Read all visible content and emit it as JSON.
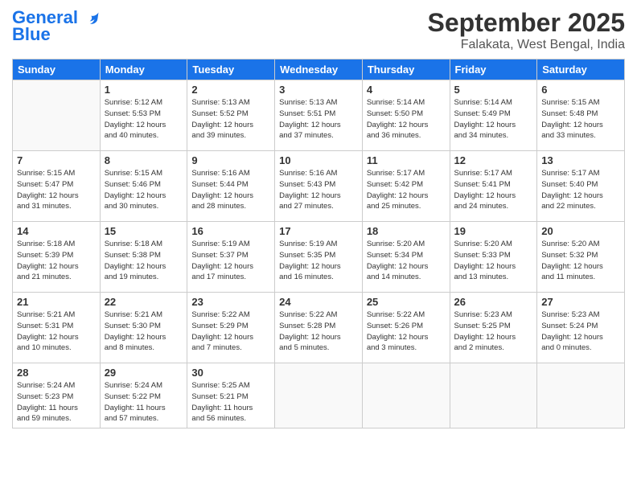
{
  "header": {
    "logo_line1": "General",
    "logo_line2": "Blue",
    "month": "September 2025",
    "location": "Falakata, West Bengal, India"
  },
  "weekdays": [
    "Sunday",
    "Monday",
    "Tuesday",
    "Wednesday",
    "Thursday",
    "Friday",
    "Saturday"
  ],
  "weeks": [
    [
      {
        "day": "",
        "info": ""
      },
      {
        "day": "1",
        "info": "Sunrise: 5:12 AM\nSunset: 5:53 PM\nDaylight: 12 hours\nand 40 minutes."
      },
      {
        "day": "2",
        "info": "Sunrise: 5:13 AM\nSunset: 5:52 PM\nDaylight: 12 hours\nand 39 minutes."
      },
      {
        "day": "3",
        "info": "Sunrise: 5:13 AM\nSunset: 5:51 PM\nDaylight: 12 hours\nand 37 minutes."
      },
      {
        "day": "4",
        "info": "Sunrise: 5:14 AM\nSunset: 5:50 PM\nDaylight: 12 hours\nand 36 minutes."
      },
      {
        "day": "5",
        "info": "Sunrise: 5:14 AM\nSunset: 5:49 PM\nDaylight: 12 hours\nand 34 minutes."
      },
      {
        "day": "6",
        "info": "Sunrise: 5:15 AM\nSunset: 5:48 PM\nDaylight: 12 hours\nand 33 minutes."
      }
    ],
    [
      {
        "day": "7",
        "info": "Sunrise: 5:15 AM\nSunset: 5:47 PM\nDaylight: 12 hours\nand 31 minutes."
      },
      {
        "day": "8",
        "info": "Sunrise: 5:15 AM\nSunset: 5:46 PM\nDaylight: 12 hours\nand 30 minutes."
      },
      {
        "day": "9",
        "info": "Sunrise: 5:16 AM\nSunset: 5:44 PM\nDaylight: 12 hours\nand 28 minutes."
      },
      {
        "day": "10",
        "info": "Sunrise: 5:16 AM\nSunset: 5:43 PM\nDaylight: 12 hours\nand 27 minutes."
      },
      {
        "day": "11",
        "info": "Sunrise: 5:17 AM\nSunset: 5:42 PM\nDaylight: 12 hours\nand 25 minutes."
      },
      {
        "day": "12",
        "info": "Sunrise: 5:17 AM\nSunset: 5:41 PM\nDaylight: 12 hours\nand 24 minutes."
      },
      {
        "day": "13",
        "info": "Sunrise: 5:17 AM\nSunset: 5:40 PM\nDaylight: 12 hours\nand 22 minutes."
      }
    ],
    [
      {
        "day": "14",
        "info": "Sunrise: 5:18 AM\nSunset: 5:39 PM\nDaylight: 12 hours\nand 21 minutes."
      },
      {
        "day": "15",
        "info": "Sunrise: 5:18 AM\nSunset: 5:38 PM\nDaylight: 12 hours\nand 19 minutes."
      },
      {
        "day": "16",
        "info": "Sunrise: 5:19 AM\nSunset: 5:37 PM\nDaylight: 12 hours\nand 17 minutes."
      },
      {
        "day": "17",
        "info": "Sunrise: 5:19 AM\nSunset: 5:35 PM\nDaylight: 12 hours\nand 16 minutes."
      },
      {
        "day": "18",
        "info": "Sunrise: 5:20 AM\nSunset: 5:34 PM\nDaylight: 12 hours\nand 14 minutes."
      },
      {
        "day": "19",
        "info": "Sunrise: 5:20 AM\nSunset: 5:33 PM\nDaylight: 12 hours\nand 13 minutes."
      },
      {
        "day": "20",
        "info": "Sunrise: 5:20 AM\nSunset: 5:32 PM\nDaylight: 12 hours\nand 11 minutes."
      }
    ],
    [
      {
        "day": "21",
        "info": "Sunrise: 5:21 AM\nSunset: 5:31 PM\nDaylight: 12 hours\nand 10 minutes."
      },
      {
        "day": "22",
        "info": "Sunrise: 5:21 AM\nSunset: 5:30 PM\nDaylight: 12 hours\nand 8 minutes."
      },
      {
        "day": "23",
        "info": "Sunrise: 5:22 AM\nSunset: 5:29 PM\nDaylight: 12 hours\nand 7 minutes."
      },
      {
        "day": "24",
        "info": "Sunrise: 5:22 AM\nSunset: 5:28 PM\nDaylight: 12 hours\nand 5 minutes."
      },
      {
        "day": "25",
        "info": "Sunrise: 5:22 AM\nSunset: 5:26 PM\nDaylight: 12 hours\nand 3 minutes."
      },
      {
        "day": "26",
        "info": "Sunrise: 5:23 AM\nSunset: 5:25 PM\nDaylight: 12 hours\nand 2 minutes."
      },
      {
        "day": "27",
        "info": "Sunrise: 5:23 AM\nSunset: 5:24 PM\nDaylight: 12 hours\nand 0 minutes."
      }
    ],
    [
      {
        "day": "28",
        "info": "Sunrise: 5:24 AM\nSunset: 5:23 PM\nDaylight: 11 hours\nand 59 minutes."
      },
      {
        "day": "29",
        "info": "Sunrise: 5:24 AM\nSunset: 5:22 PM\nDaylight: 11 hours\nand 57 minutes."
      },
      {
        "day": "30",
        "info": "Sunrise: 5:25 AM\nSunset: 5:21 PM\nDaylight: 11 hours\nand 56 minutes."
      },
      {
        "day": "",
        "info": ""
      },
      {
        "day": "",
        "info": ""
      },
      {
        "day": "",
        "info": ""
      },
      {
        "day": "",
        "info": ""
      }
    ]
  ]
}
